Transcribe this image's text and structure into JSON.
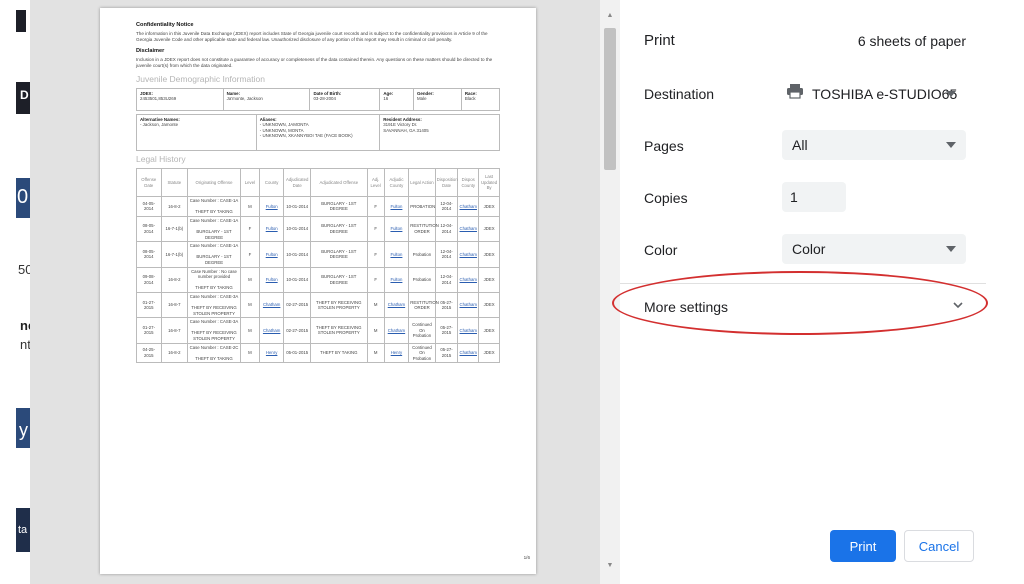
{
  "bg_fragments": [
    "D",
    "0",
    "50",
    "ne",
    "nt",
    "y",
    "ta"
  ],
  "document": {
    "confidentiality_heading": "Confidentiality Notice",
    "confidentiality_text": "The information in this Juvenile Data Exchange (JDEX) report includes State of Georgia juvenile court records and is subject to the confidentiality provisions in Article 9 of the Georgia Juvenile Code and other applicable state and federal law. Unauthorized disclosure of any portion of this report may result in criminal or civil penalty.",
    "disclaimer_heading": "Disclaimer",
    "disclaimer_text": "Inclusion in a JDEX report does not constitute a guarantee of accuracy or completeness of the data contained therein. Any questions on these matters should be directed to the juvenile court(s) from which the data originated.",
    "demographic_title": "Juvenile Demographic Information",
    "demographics": {
      "jdex_label": "JDEX:",
      "jdex_value": "2453501,853U269",
      "name_label": "Name:",
      "name_value": "Ja'monte, Jackson",
      "dob_label": "Date of Birth:",
      "dob_value": "03-28-2004",
      "age_label": "Age:",
      "age_value": "16",
      "gender_label": "Gender:",
      "gender_value": "Male",
      "race_label": "Race:",
      "race_value": "Black",
      "alt_names_label": "Alternative Names:",
      "alt_names_value": "- Jackson, Jamonte",
      "aliases_label": "Aliases:",
      "aliases_value": "- UNKNOWN, JAMONTA\n- UNKNOWN, MONTA\n- UNKNOWN, XKANNYBOI TAE (FACE BOOK)",
      "address_label": "Resident Address:",
      "address_value": "3191E Victory Dr.\nSAVANNAH, GA 31405"
    },
    "legal_history_title": "Legal History",
    "legal_headers": [
      "Offense Date",
      "Statute",
      "Originating Offense",
      "Level",
      "County",
      "Adjudicated Date",
      "Adjudicated Offense",
      "Adj. Level",
      "Adjudic County",
      "Legal Action",
      "Disposition Date",
      "Dispos County",
      "Last Updated By"
    ],
    "legal_rows": [
      [
        "04-05-2014",
        "16-8-2",
        "Case Number : CASE-1A\n\nTHEFT BY TAKING",
        "M",
        "Fulton",
        "10-01-2014",
        "BURGLARY - 1ST DEGREE",
        "F",
        "Fulton",
        "PROBATION",
        "12-04-2014",
        "Chatham",
        "JDEX"
      ],
      [
        "08-05-2014",
        "16-7-1(b)",
        "Case Number : CASE-1A\n\nBURGLARY - 1ST DEGREE",
        "F",
        "Fulton",
        "10-01-2014",
        "BURGLARY - 1ST DEGREE",
        "F",
        "Fulton",
        "RESTITUTION ORDER",
        "12-04-2014",
        "Chatham",
        "JDEX"
      ],
      [
        "08-05-2014",
        "16-7-1(b)",
        "Case Number : CASE-1A\n\nBURGLARY - 1ST DEGREE",
        "F",
        "Fulton",
        "10-01-2014",
        "BURGLARY - 1ST DEGREE",
        "F",
        "Fulton",
        "Probation",
        "12-04-2014",
        "Chatham",
        "JDEX"
      ],
      [
        "09-08-2014",
        "16-8-2",
        "Case Number : No case number provided\n\nTHEFT BY TAKING",
        "M",
        "Fulton",
        "10-01-2014",
        "BURGLARY - 1ST DEGREE",
        "F",
        "Fulton",
        "Probation",
        "12-04-2014",
        "Chatham",
        "JDEX"
      ],
      [
        "01-27-2015",
        "16-8-7",
        "Case Number : CASE-3A\n\nTHEFT BY RECEIVING STOLEN PROPERTY",
        "M",
        "Chatham",
        "02-27-2015",
        "THEFT BY RECEIVING STOLEN PROPERTY",
        "M",
        "Chatham",
        "RESTITUTION ORDER",
        "05-27-2015",
        "Chatham",
        "JDEX"
      ],
      [
        "01-27-2015",
        "16-8-7",
        "Case Number : CASE-3A\n\nTHEFT BY RECEIVING STOLEN PROPERTY",
        "M",
        "Chatham",
        "02-27-2015",
        "THEFT BY RECEIVING STOLEN PROPERTY",
        "M",
        "Chatham",
        "Continued On Probation",
        "05-27-2015",
        "Chatham",
        "JDEX"
      ],
      [
        "04-25-2015",
        "16-8-2",
        "Case Number : CASE-2C\n\nTHEFT BY TAKING",
        "M",
        "Henry",
        "05-01-2015",
        "THEFT BY TAKING",
        "M",
        "Henry",
        "Continued On Probation",
        "05-27-2015",
        "Chatham",
        "JDEX"
      ]
    ],
    "page_number": "1/6"
  },
  "panel": {
    "title": "Print",
    "sheets": "6 sheets of paper",
    "destination_label": "Destination",
    "destination_value": "TOSHIBA e-STUDIO65",
    "pages_label": "Pages",
    "pages_value": "All",
    "copies_label": "Copies",
    "copies_value": "1",
    "color_label": "Color",
    "color_value": "Color",
    "more_settings_label": "More settings",
    "print_button": "Print",
    "cancel_button": "Cancel",
    "highlight_color": "#d32f2f",
    "accent_color": "#1a73e8"
  },
  "icons": {
    "printer": "printer-icon",
    "caret": "caret-down-icon",
    "chevron": "chevron-down-icon",
    "scroll_up": "scroll-up-arrow-icon",
    "scroll_down": "scroll-down-arrow-icon"
  }
}
